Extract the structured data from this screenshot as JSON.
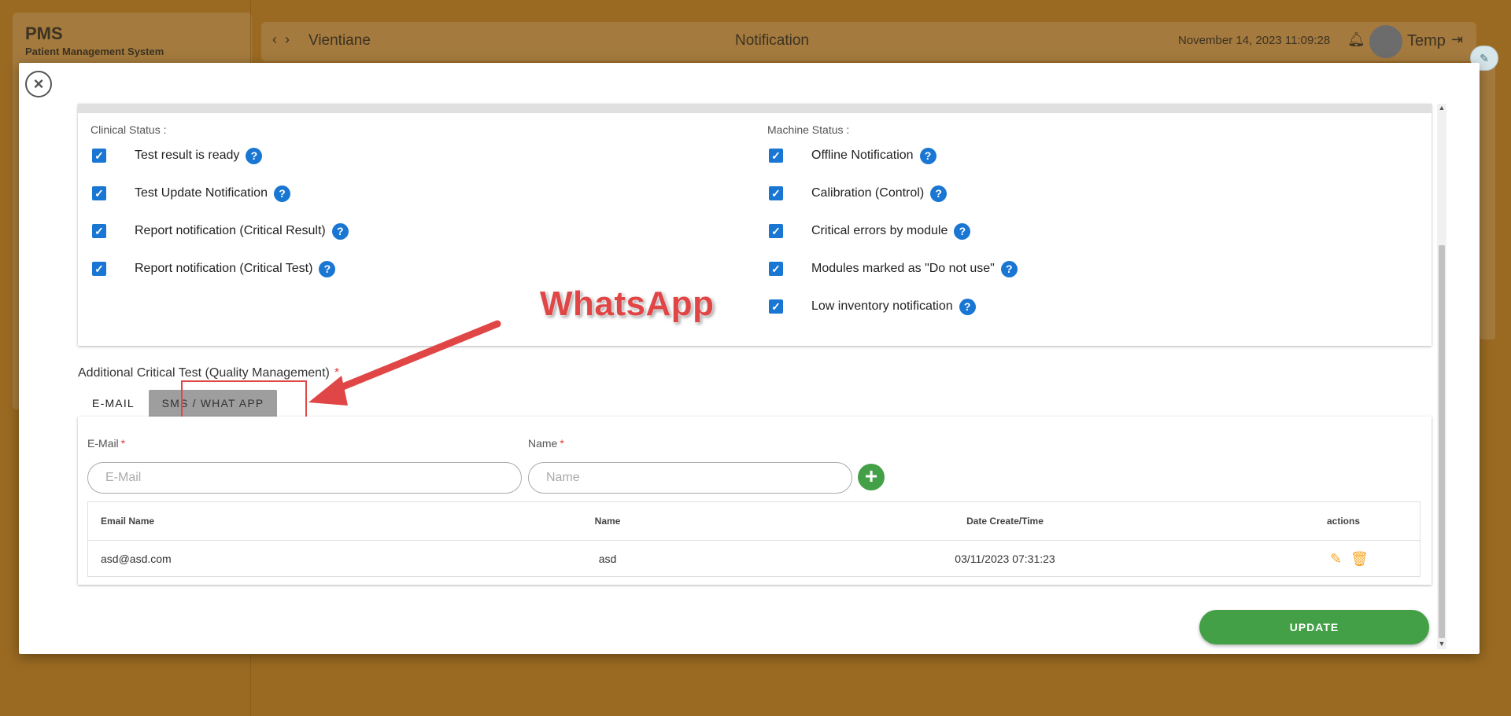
{
  "app": {
    "title": "PMS",
    "subtitle": "Patient Management System"
  },
  "header": {
    "back_icon": "chevron-left",
    "forward_icon": "chevron-right",
    "location": "Vientiane",
    "page_title": "Notification",
    "datetime": "November 14, 2023 11:09:28",
    "user": "Temp"
  },
  "modal": {
    "clinical_status_label": "Clinical Status :",
    "machine_status_label": "Machine Status :",
    "clinical_items": [
      {
        "label": "Test result is ready",
        "checked": true
      },
      {
        "label": "Test Update Notification",
        "checked": true
      },
      {
        "label": "Report notification (Critical Result)",
        "checked": true
      },
      {
        "label": "Report notification (Critical Test)",
        "checked": true
      }
    ],
    "machine_items": [
      {
        "label": "Offline Notification",
        "checked": true
      },
      {
        "label": "Calibration (Control)",
        "checked": true
      },
      {
        "label": "Critical errors by module",
        "checked": true
      },
      {
        "label": "Modules marked as \"Do not use\"",
        "checked": true
      },
      {
        "label": "Low inventory notification",
        "checked": true
      }
    ],
    "critical_test_title": "Additional Critical Test (Quality Management)",
    "required_mark": "*",
    "tabs": [
      "E-MAIL",
      "SMS / WHAT APP"
    ],
    "active_tab": "SMS / WHAT APP",
    "form": {
      "email_label": "E-Mail",
      "email_placeholder": "E-Mail",
      "email_value": "",
      "name_label": "Name",
      "name_placeholder": "Name",
      "name_value": ""
    },
    "table": {
      "headers": [
        "Email Name",
        "Name",
        "Date Create/Time",
        "actions"
      ],
      "rows": [
        {
          "email": "asd@asd.com",
          "name": "asd",
          "date": "03/11/2023 07:31:23"
        }
      ]
    },
    "update_label": "UPDATE"
  },
  "annotation": {
    "text": "WhatsApp",
    "color": "#e04646"
  },
  "colors": {
    "accent": "#1976d2",
    "success": "#43a047",
    "warning": "#f5a623",
    "danger": "#e53935"
  }
}
